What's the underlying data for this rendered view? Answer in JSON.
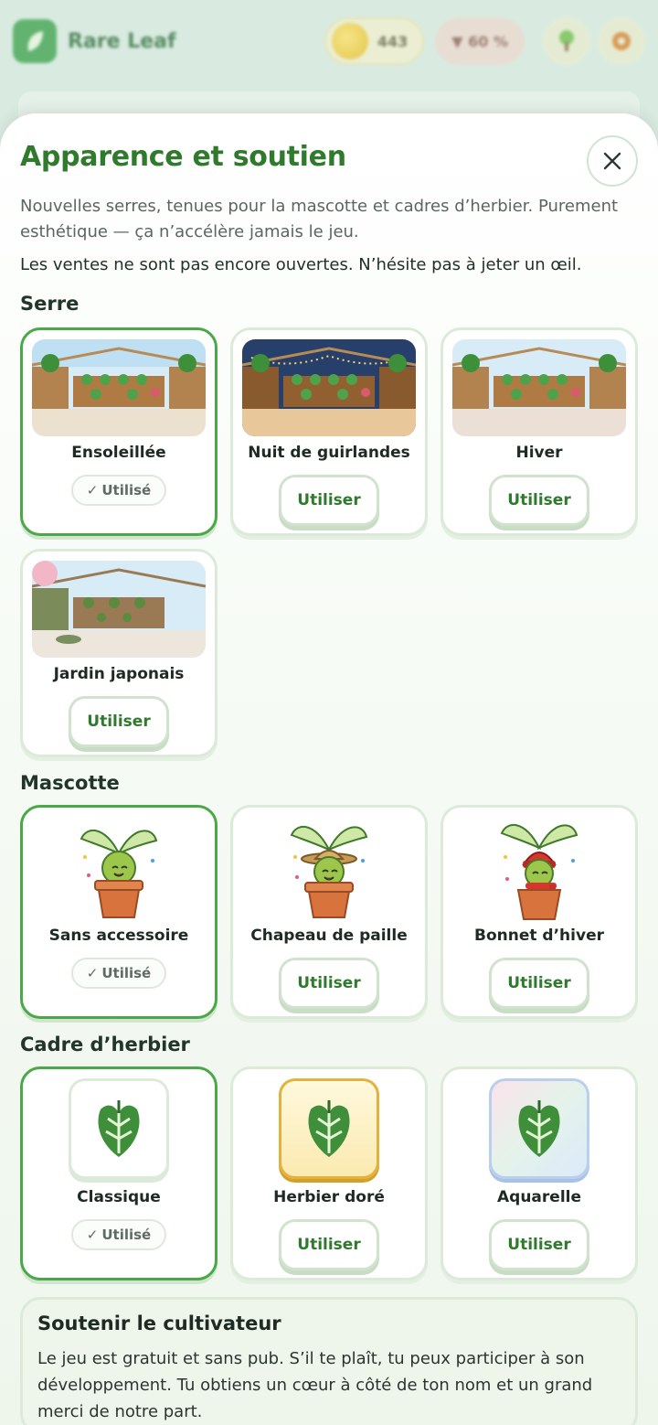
{
  "app": {
    "name": "Rare Leaf",
    "coins": "443",
    "progress": "▼ 60 %"
  },
  "sheet": {
    "title": "Apparence et soutien",
    "intro": "Nouvelles serres, tenues pour la mascotte et cadres d’herbier. Purement esthétique — ça n’accélère jamais le jeu.",
    "notice": "Les ventes ne sont pas encore ouvertes. N’hésite pas à jeter un œil.",
    "used_label": "Utilisé",
    "use_label": "Utiliser"
  },
  "sections": {
    "greenhouse": "Serre",
    "mascot": "Mascotte",
    "frame": "Cadre d’herbier"
  },
  "greenhouse": [
    {
      "name": "Ensoleillée",
      "active": true
    },
    {
      "name": "Nuit de guirlandes",
      "active": false
    },
    {
      "name": "Hiver",
      "active": false
    },
    {
      "name": "Jardin japonais",
      "active": false
    }
  ],
  "mascot": [
    {
      "name": "Sans accessoire",
      "active": true
    },
    {
      "name": "Chapeau de paille",
      "active": false
    },
    {
      "name": "Bonnet d’hiver",
      "active": false
    }
  ],
  "frame": [
    {
      "name": "Classique",
      "active": true
    },
    {
      "name": "Herbier doré",
      "active": false
    },
    {
      "name": "Aquarelle",
      "active": false
    }
  ],
  "support": {
    "title": "Soutenir le cultivateur",
    "text": "Le jeu est gratuit et sans pub. S’il te plaît, tu peux participer à son développement. Tu obtiens un cœur à côté de ton nom et un grand merci de notre part."
  },
  "colors": {
    "accent": "#2f7a2c",
    "active_border": "#4aa848"
  }
}
